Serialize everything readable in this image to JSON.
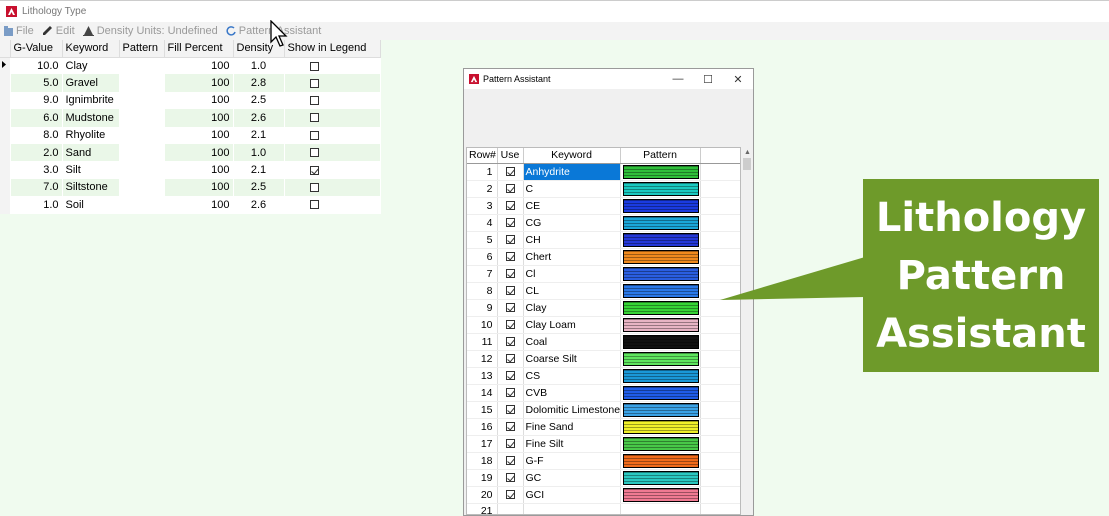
{
  "window": {
    "title": "Lithology Type"
  },
  "menu": {
    "file": "File",
    "edit": "Edit",
    "density_units": "Density Units: Undefined",
    "pattern_assistant": "Pattern Assistant"
  },
  "grid": {
    "headers": [
      "G-Value",
      "Keyword",
      "Pattern",
      "Fill Percent",
      "Density",
      "Show in Legend"
    ],
    "rows": [
      {
        "g": "10.0",
        "kw": "Clay",
        "fill": "100",
        "dens": "1.0",
        "legend": false
      },
      {
        "g": "5.0",
        "kw": "Gravel",
        "fill": "100",
        "dens": "2.8",
        "legend": false
      },
      {
        "g": "9.0",
        "kw": "Ignimbrite",
        "fill": "100",
        "dens": "2.5",
        "legend": false
      },
      {
        "g": "6.0",
        "kw": "Mudstone",
        "fill": "100",
        "dens": "2.6",
        "legend": false
      },
      {
        "g": "8.0",
        "kw": "Rhyolite",
        "fill": "100",
        "dens": "2.1",
        "legend": false
      },
      {
        "g": "2.0",
        "kw": "Sand",
        "fill": "100",
        "dens": "1.0",
        "legend": false
      },
      {
        "g": "3.0",
        "kw": "Silt",
        "fill": "100",
        "dens": "2.1",
        "legend": true
      },
      {
        "g": "7.0",
        "kw": "Siltstone",
        "fill": "100",
        "dens": "2.5",
        "legend": false
      },
      {
        "g": "1.0",
        "kw": "Soil",
        "fill": "100",
        "dens": "2.6",
        "legend": false
      }
    ]
  },
  "dialog": {
    "title": "Pattern Assistant",
    "headers": [
      "Row#",
      "Use",
      "Keyword",
      "Pattern"
    ],
    "rows": [
      {
        "n": "1",
        "kw": "Anhydrite",
        "color": "#2fbf3a",
        "selected": true
      },
      {
        "n": "2",
        "kw": "C",
        "color": "#19c9c0"
      },
      {
        "n": "3",
        "kw": "CE",
        "color": "#1a3be0"
      },
      {
        "n": "4",
        "kw": "CG",
        "color": "#1aa6d8"
      },
      {
        "n": "5",
        "kw": "CH",
        "color": "#2438d8"
      },
      {
        "n": "6",
        "kw": "Chert",
        "color": "#f08a1e"
      },
      {
        "n": "7",
        "kw": "Cl",
        "color": "#2a5ee0"
      },
      {
        "n": "8",
        "kw": "CL",
        "color": "#2a78e8"
      },
      {
        "n": "9",
        "kw": "Clay",
        "color": "#36d436"
      },
      {
        "n": "10",
        "kw": "Clay Loam",
        "color": "#e8b4c4"
      },
      {
        "n": "11",
        "kw": "Coal",
        "color": "#111111"
      },
      {
        "n": "12",
        "kw": "Coarse Silt",
        "color": "#5ee65e"
      },
      {
        "n": "13",
        "kw": "CS",
        "color": "#1a98d8"
      },
      {
        "n": "14",
        "kw": "CVB",
        "color": "#1f5ce8"
      },
      {
        "n": "15",
        "kw": "Dolomitic Limestone",
        "color": "#3aa2e6"
      },
      {
        "n": "16",
        "kw": "Fine Sand",
        "color": "#f0f02a"
      },
      {
        "n": "17",
        "kw": "Fine Silt",
        "color": "#48c848"
      },
      {
        "n": "18",
        "kw": "G-F",
        "color": "#f06a1a"
      },
      {
        "n": "19",
        "kw": "GC",
        "color": "#2ac8c0"
      },
      {
        "n": "20",
        "kw": "GCI",
        "color": "#f07a92"
      },
      {
        "n": "21",
        "kw": "",
        "color": ""
      }
    ]
  },
  "callout": {
    "lines": [
      "Lithology",
      "Pattern",
      "Assistant"
    ],
    "color": "#6e9a2a"
  }
}
